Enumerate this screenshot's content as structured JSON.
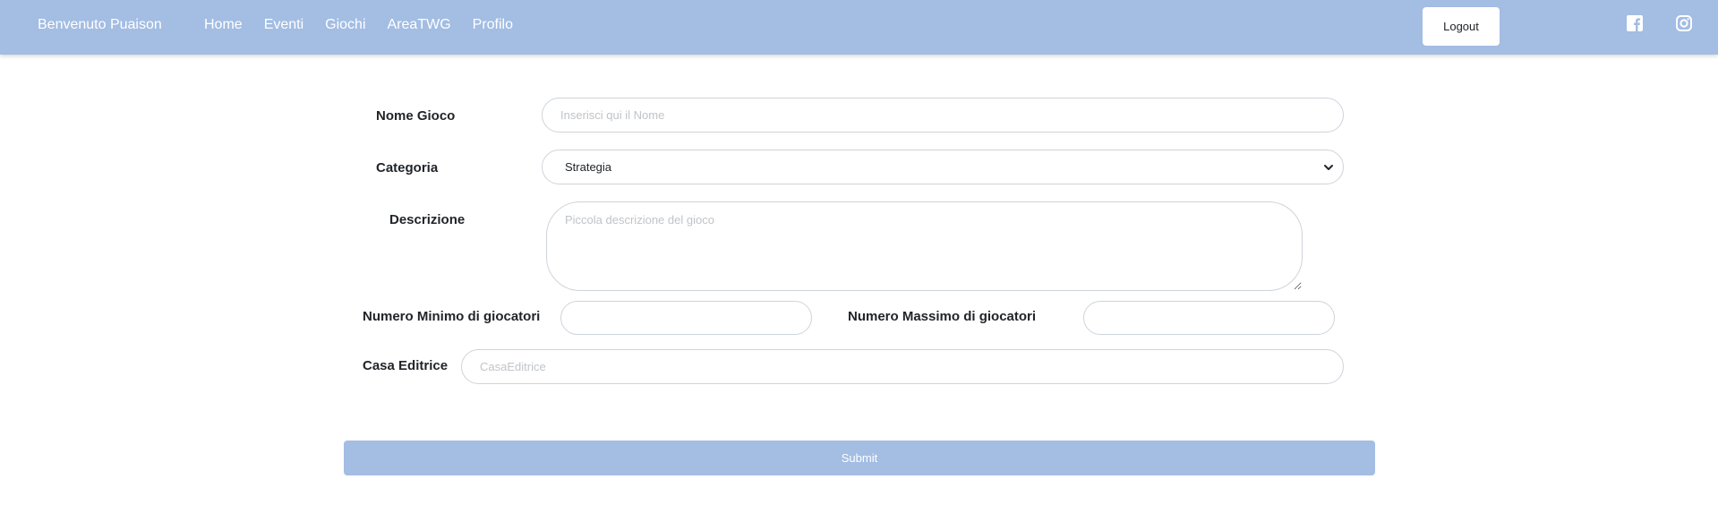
{
  "navbar": {
    "brand": "Benvenuto Puaison",
    "links": [
      "Home",
      "Eventi",
      "Giochi",
      "AreaTWG",
      "Profilo"
    ],
    "logout_label": "Logout",
    "social_icons": [
      "facebook-icon",
      "instagram-icon"
    ],
    "background_color": "#a3bde3"
  },
  "form": {
    "nome_gioco": {
      "label": "Nome Gioco",
      "placeholder": "Inserisci qui il Nome",
      "value": ""
    },
    "categoria": {
      "label": "Categoria",
      "selected": "Strategia"
    },
    "descrizione": {
      "label": "Descrizione",
      "placeholder": "Piccola descrizione del gioco",
      "value": ""
    },
    "min_giocatori": {
      "label": "Numero Minimo di giocatori",
      "value": ""
    },
    "max_giocatori": {
      "label": "Numero Massimo di giocatori",
      "value": ""
    },
    "casa_editrice": {
      "label": "Casa Editrice",
      "placeholder": "CasaEditrice",
      "value": ""
    },
    "submit_label": "Submit"
  }
}
